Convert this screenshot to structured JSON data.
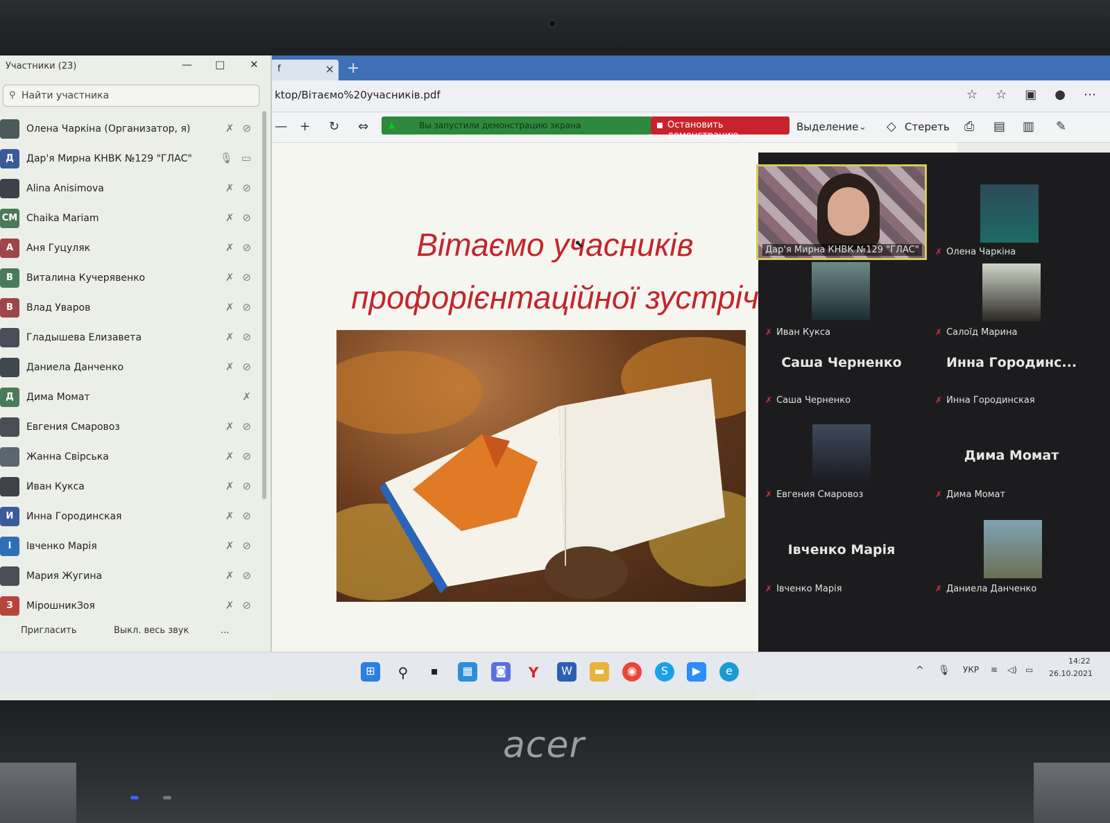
{
  "participants_panel": {
    "title": "Участники (23)",
    "search_placeholder": "Найти участника",
    "rows": [
      {
        "avatar": "",
        "name": "Олена Чаркіна (Организатор, я)"
      },
      {
        "avatar": "Д",
        "name": "Дар'я Мирна КНВК №129 \"ГЛАС\""
      },
      {
        "avatar": "",
        "name": "Alina Anisimova"
      },
      {
        "avatar": "CM",
        "name": "Chaika Mariam"
      },
      {
        "avatar": "А",
        "name": "Аня Гуцуляк"
      },
      {
        "avatar": "В",
        "name": "Виталина Кучерявенко"
      },
      {
        "avatar": "В",
        "name": "Влад Уваров"
      },
      {
        "avatar": "",
        "name": "Гладышева Елизавета"
      },
      {
        "avatar": "",
        "name": "Даниела Данченко"
      },
      {
        "avatar": "Д",
        "name": "Дима Момат"
      },
      {
        "avatar": "",
        "name": "Евгения Смаровоз"
      },
      {
        "avatar": "",
        "name": "Жанна Свірська"
      },
      {
        "avatar": "",
        "name": "Иван Кукса"
      },
      {
        "avatar": "И",
        "name": "Инна Городинская"
      },
      {
        "avatar": "І",
        "name": "Івченко Марія"
      },
      {
        "avatar": "",
        "name": "Мария Жугина"
      },
      {
        "avatar": "З",
        "name": "МірошникЗоя"
      }
    ],
    "footer": {
      "invite": "Пригласить",
      "mute_all": "Выкл. весь звук",
      "more": "..."
    }
  },
  "browser": {
    "tab_close": "×",
    "new_tab": "+",
    "url": "ktop/Вітаємо%20учасників.pdf",
    "toolbar": {
      "zoom_out": "—",
      "zoom_in": "+",
      "share_banner": "Вы запустили демонстрацию экрана",
      "stop_share": "Остановить демонстрацию",
      "highlight": "Выделение",
      "erase": "Стереть"
    }
  },
  "slide": {
    "title_line1": "Вітаємо учасників",
    "title_line2": "профорієнтаційної зустріч"
  },
  "gallery": {
    "tiles": [
      {
        "label": "Дар'я Мирна КНВК №129 \"ГЛАС\"",
        "big": ""
      },
      {
        "label": "Олена Чаркіна",
        "big": ""
      },
      {
        "label": "Иван Кукса",
        "big": ""
      },
      {
        "label": "Салоїд Марина",
        "big": ""
      },
      {
        "label": "Саша Черненко",
        "big": "Саша Черненко"
      },
      {
        "label": "Инна Городинская",
        "big": "Инна Городинс..."
      },
      {
        "label": "Евгения Смаровоз",
        "big": ""
      },
      {
        "label": "Дима Момат",
        "big": "Дима Момат"
      },
      {
        "label": "Івченко Марія",
        "big": "Івченко Марія"
      },
      {
        "label": "Даниела Данченко",
        "big": ""
      }
    ]
  },
  "taskbar": {
    "lang": "УКР",
    "time": "14:22",
    "date": "26.10.2021"
  },
  "laptop": {
    "brand": "acer"
  },
  "colors": {
    "stop_red": "#c8232c",
    "share_green": "#2d8a3c",
    "slide_title": "#c3262a",
    "muted_mic": "#e0313a",
    "active_border": "#d5cc58"
  }
}
